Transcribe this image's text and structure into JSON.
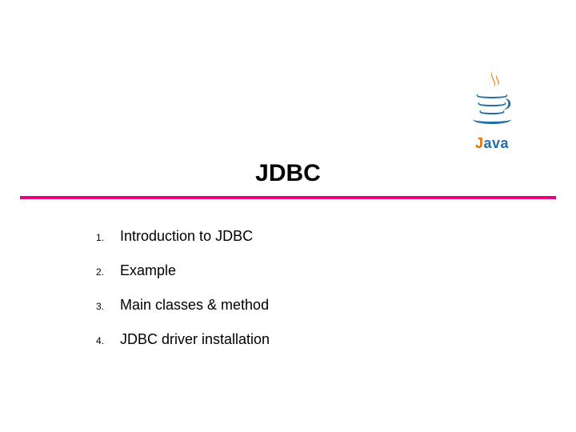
{
  "logo": {
    "name": "Java"
  },
  "title": "JDBC",
  "items": [
    {
      "num": "1.",
      "text": "Introduction to JDBC"
    },
    {
      "num": "2.",
      "text": "Example"
    },
    {
      "num": "3.",
      "text": "Main classes & method"
    },
    {
      "num": "4.",
      "text": "JDBC driver installation"
    }
  ]
}
